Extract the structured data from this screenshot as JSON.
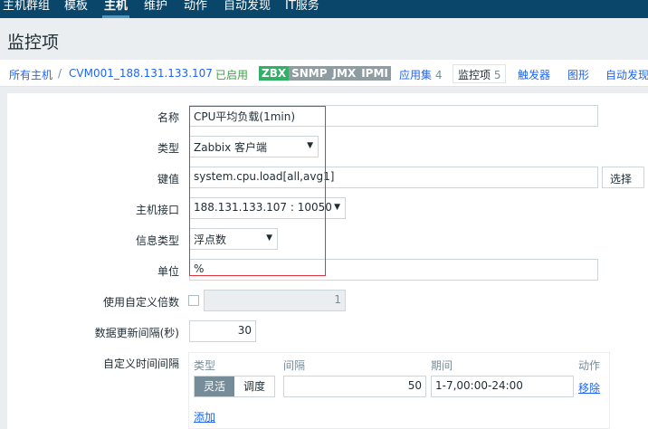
{
  "topnav": {
    "tabs": [
      {
        "label": "主机群组",
        "active": false
      },
      {
        "label": "模板",
        "active": false
      },
      {
        "label": "主机",
        "active": true
      },
      {
        "label": "维护",
        "active": false
      },
      {
        "label": "动作",
        "active": false
      },
      {
        "label": "自动发现",
        "active": false
      },
      {
        "label": "IT服务",
        "active": false
      }
    ]
  },
  "page_title": "监控项",
  "breadcrumb": {
    "all_hosts": "所有主机",
    "separator": "/",
    "host": "CVM001_188.131.133.107",
    "status": "已启用",
    "badges": [
      "ZBX",
      "SNMP",
      "JMX",
      "IPMI"
    ],
    "tabs": [
      {
        "label": "应用集",
        "count": "4"
      },
      {
        "label": "监控项",
        "count": "5",
        "selected": true
      },
      {
        "label": "触发器",
        "count": ""
      },
      {
        "label": "图形",
        "count": ""
      },
      {
        "label": "自动发现",
        "count": ""
      }
    ]
  },
  "form": {
    "name": {
      "label": "名称",
      "value": "CPU平均负载(1min)"
    },
    "type": {
      "label": "类型",
      "value": "Zabbix 客户端"
    },
    "key": {
      "label": "键值",
      "value": "system.cpu.load[all,avg1]",
      "button": "选择"
    },
    "interface": {
      "label": "主机接口",
      "value": "188.131.133.107 : 10050"
    },
    "info_type": {
      "label": "信息类型",
      "value": "浮点数"
    },
    "units": {
      "label": "单位",
      "value": "%"
    },
    "multiplier": {
      "label": "使用自定义倍数",
      "value": "1",
      "checked": false
    },
    "interval": {
      "label": "数据更新间隔(秒)",
      "value": "30"
    },
    "custom_intervals": {
      "label": "自定义时间间隔",
      "headers": {
        "type": "类型",
        "interval": "间隔",
        "period": "期间",
        "action": "动作"
      },
      "row": {
        "mode_flexible": "灵活",
        "mode_scheduling": "调度",
        "interval": "50",
        "period": "1-7,00:00-24:00",
        "remove": "移除"
      },
      "add": "添加"
    }
  },
  "colors": {
    "nav_bg": "#0a466a",
    "link": "#1f65f4",
    "enabled": "#429e47",
    "zbx_badge": "#34af67",
    "highlight_box": "#e0323f"
  }
}
